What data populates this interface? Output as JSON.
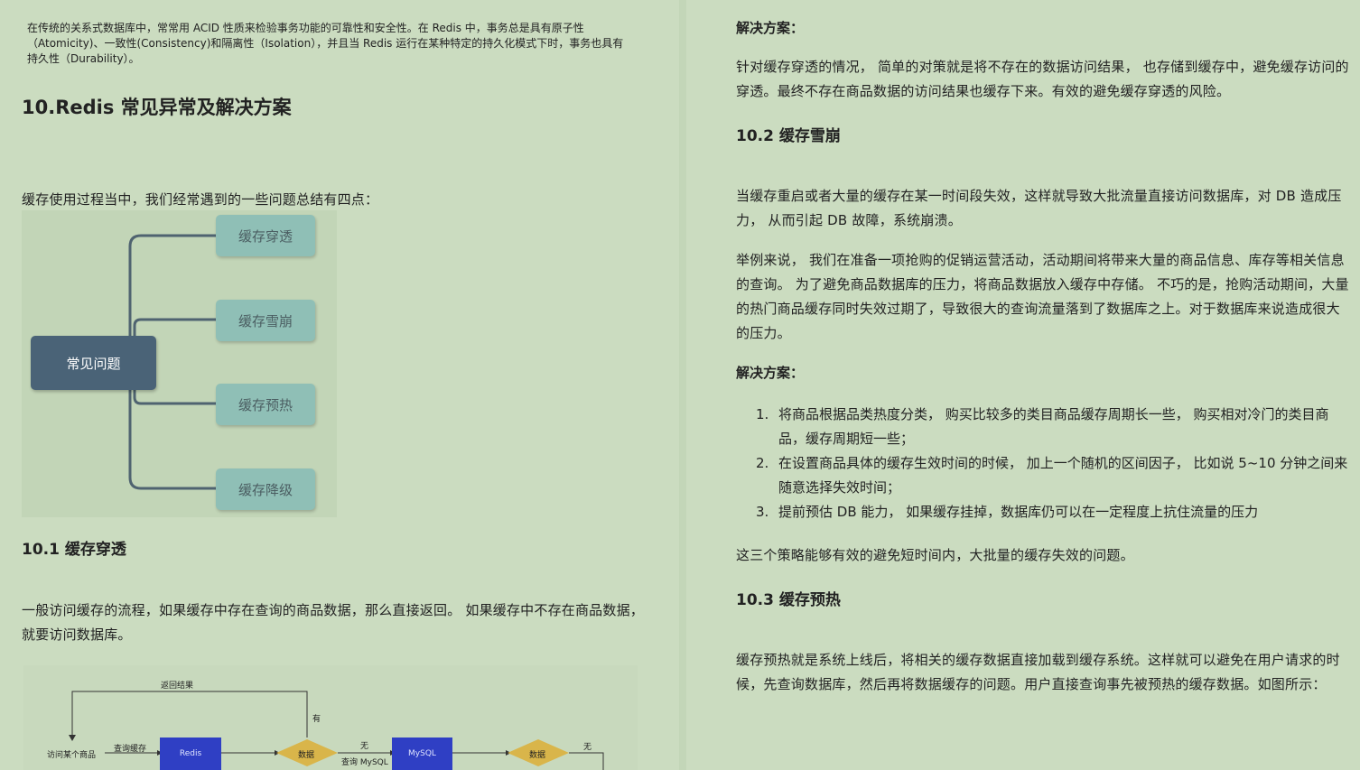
{
  "left": {
    "intro": "在传统的关系式数据库中，常常用 ACID 性质来检验事务功能的可靠性和安全性。在 Redis 中，事务总是具有原子性（Atomicity)、一致性(Consistency)和隔离性（Isolation），并且当 Redis 运行在某种特定的持久化模式下时，事务也具有持久性（Durability）。",
    "section_title": "10.Redis 常见异常及解决方案",
    "summary": "缓存使用过程当中，我们经常遇到的一些问题总结有四点：",
    "mindmap": {
      "root": "常见问题",
      "leaves": [
        "缓存穿透",
        "缓存雪崩",
        "缓存预热",
        "缓存降级"
      ]
    },
    "sub1_title": "10.1 缓存穿透",
    "sub1_text": "一般访问缓存的流程，如果缓存中存在查询的商品数据，那么直接返回。 如果缓存中不存在商品数据， 就要访问数据库。",
    "flow": {
      "return_label": "返回结果",
      "visit": "访问某个商品",
      "query_cache": "查询缓存",
      "redis": "Redis",
      "data1": "数据",
      "has": "有",
      "none1": "无",
      "query_mysql": "查询 MySQL",
      "mysql": "MySQL",
      "data2": "数据",
      "none2": "无"
    }
  },
  "right": {
    "solution_label_1": "解决方案：",
    "solution_text_1": "针对缓存穿透的情况， 简单的对策就是将不存在的数据访问结果， 也存储到缓存中，避免缓存访问的穿透。最终不存在商品数据的访问结果也缓存下来。有效的避免缓存穿透的风险。",
    "sub2_title": "10.2 缓存雪崩",
    "avalanche_p1": "当缓存重启或者大量的缓存在某一时间段失效，这样就导致大批流量直接访问数据库，对 DB 造成压力， 从而引起 DB 故障，系统崩溃。",
    "avalanche_p2": "举例来说， 我们在准备一项抢购的促销运营活动，活动期间将带来大量的商品信息、库存等相关信息的查询。 为了避免商品数据库的压力，将商品数据放入缓存中存储。 不巧的是，抢购活动期间，大量的热门商品缓存同时失效过期了，导致很大的查询流量落到了数据库之上。对于数据库来说造成很大的压力。",
    "solution_label_2": "解决方案：",
    "solutions": [
      {
        "num": "1.",
        "text": "将商品根据品类热度分类， 购买比较多的类目商品缓存周期长一些， 购买相对冷门的类目商品，缓存周期短一些；"
      },
      {
        "num": "2.",
        "text": "在设置商品具体的缓存生效时间的时候， 加上一个随机的区间因子， 比如说 5~10 分钟之间来随意选择失效时间；"
      },
      {
        "num": "3.",
        "text": "提前预估 DB 能力， 如果缓存挂掉，数据库仍可以在一定程度上抗住流量的压力"
      }
    ],
    "strategy_text": "这三个策略能够有效的避免短时间内，大批量的缓存失效的问题。",
    "sub3_title": "10.3 缓存预热",
    "warmup_text": "缓存预热就是系统上线后，将相关的缓存数据直接加载到缓存系统。这样就可以避免在用户请求的时候，先查询数据库，然后再将数据缓存的问题。用户直接查询事先被预热的缓存数据。如图所示："
  },
  "colors": {
    "page_bg": "#cbdcc0",
    "root_node": "#4a6377",
    "leaf_node": "#8fbfb6",
    "redis_box": "#2f3fc4",
    "decision": "#d9b54a"
  }
}
